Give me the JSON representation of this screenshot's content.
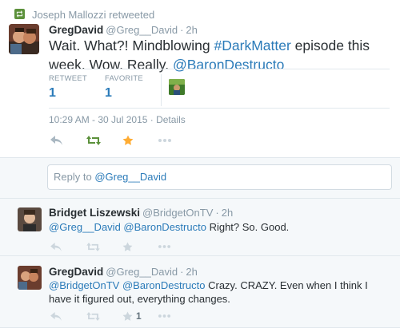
{
  "retweet_header": {
    "text": "Joseph Mallozzi retweeted"
  },
  "main_tweet": {
    "fullname": "GregDavid",
    "handle": "@Greg__David",
    "separator": "·",
    "time": "2h",
    "text_before": "Wait. What?! Mindblowing ",
    "hashtag": "#DarkMatter",
    "text_middle": " episode this week. Wow. Really. ",
    "mention": "@BaronDestructo",
    "stats": {
      "retweet_label": "RETWEET",
      "retweet_count": "1",
      "favorite_label": "FAVORITE",
      "favorite_count": "1"
    },
    "datetime": "10:29 AM - 30 Jul 2015 · Details"
  },
  "reply_box": {
    "prefix": "Reply to ",
    "to": "@Greg__David"
  },
  "replies": [
    {
      "fullname": "Bridget Liszewski",
      "handle": "@BridgetOnTV",
      "separator": "·",
      "time": "2h",
      "mention1": "@Greg__David",
      "mention2": "@BaronDestructo",
      "text": " Right? So. Good.",
      "fav_count": ""
    },
    {
      "fullname": "GregDavid",
      "handle": "@Greg__David",
      "separator": "·",
      "time": "2h",
      "mention1": "@BridgetOnTV",
      "mention2": "@BaronDestructo",
      "text": " Crazy. CRAZY. Even when I think I have it figured out, everything changes.",
      "fav_count": "1"
    }
  ],
  "colors": {
    "link": "#2b7bb9",
    "retweet_active": "#5c913b",
    "favorite_active": "#ffac33",
    "muted": "#8899a6"
  },
  "icons": [
    "retweet-badge-icon",
    "reply-icon",
    "retweet-icon",
    "favorite-star-icon",
    "more-dots-icon"
  ]
}
